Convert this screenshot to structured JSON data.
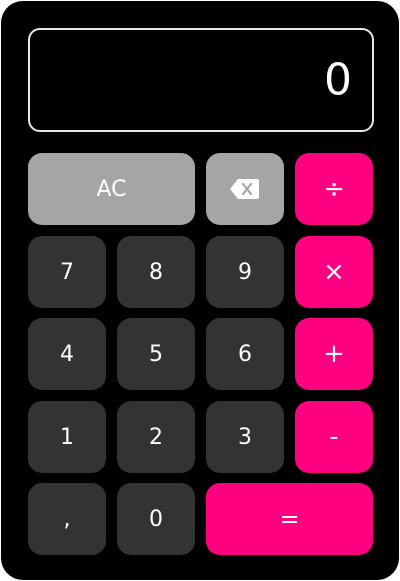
{
  "display": {
    "value": "0"
  },
  "keys": {
    "clear": "AC",
    "backspace_icon": "backspace-icon",
    "divide": "÷",
    "seven": "7",
    "eight": "8",
    "nine": "9",
    "multiply": "×",
    "four": "4",
    "five": "5",
    "six": "6",
    "plus": "+",
    "one": "1",
    "two": "2",
    "three": "3",
    "minus": "-",
    "comma": ",",
    "zero": "0",
    "equals": "="
  },
  "colors": {
    "accent": "#ff0080",
    "number_key": "#333333",
    "function_key": "#a5a5a5",
    "background": "#000000",
    "text": "#ffffff"
  }
}
